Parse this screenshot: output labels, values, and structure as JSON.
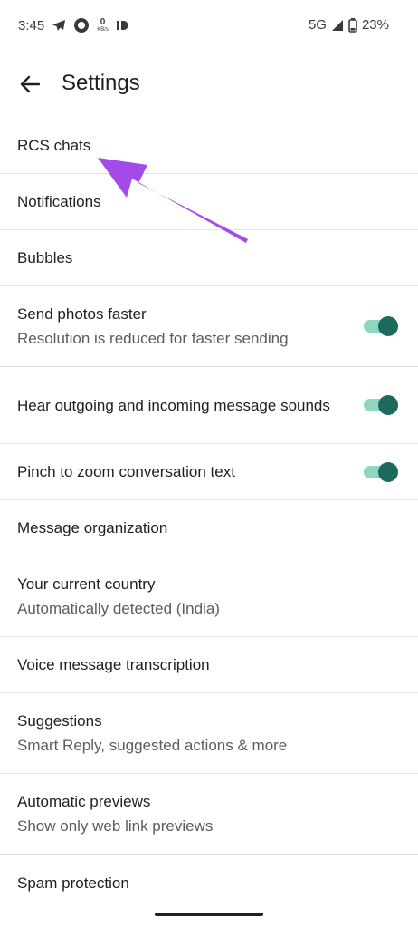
{
  "status_bar": {
    "time": "3:45",
    "net_speed_value": "0",
    "net_speed_unit": "KB/s",
    "network_type": "5G",
    "battery_percent": "23%"
  },
  "app_bar": {
    "title": "Settings",
    "back_icon": "arrow-left-icon"
  },
  "settings": [
    {
      "title": "RCS chats"
    },
    {
      "title": "Notifications"
    },
    {
      "title": "Bubbles"
    },
    {
      "title": "Send photos faster",
      "subtitle": "Resolution is reduced for faster sending",
      "toggle": true
    },
    {
      "title": "Hear outgoing and incoming message sounds",
      "toggle": true
    },
    {
      "title": "Pinch to zoom conversation text",
      "toggle": true
    },
    {
      "title": "Message organization"
    },
    {
      "title": "Your current country",
      "subtitle": "Automatically detected (India)"
    },
    {
      "title": "Voice message transcription"
    },
    {
      "title": "Suggestions",
      "subtitle": "Smart Reply, suggested actions & more"
    },
    {
      "title": "Automatic previews",
      "subtitle": "Show only web link previews"
    },
    {
      "title": "Spam protection"
    }
  ],
  "colors": {
    "toggle_track": "#8fd6bf",
    "toggle_thumb": "#1d6a5d",
    "annotation_arrow": "#a24be8"
  }
}
